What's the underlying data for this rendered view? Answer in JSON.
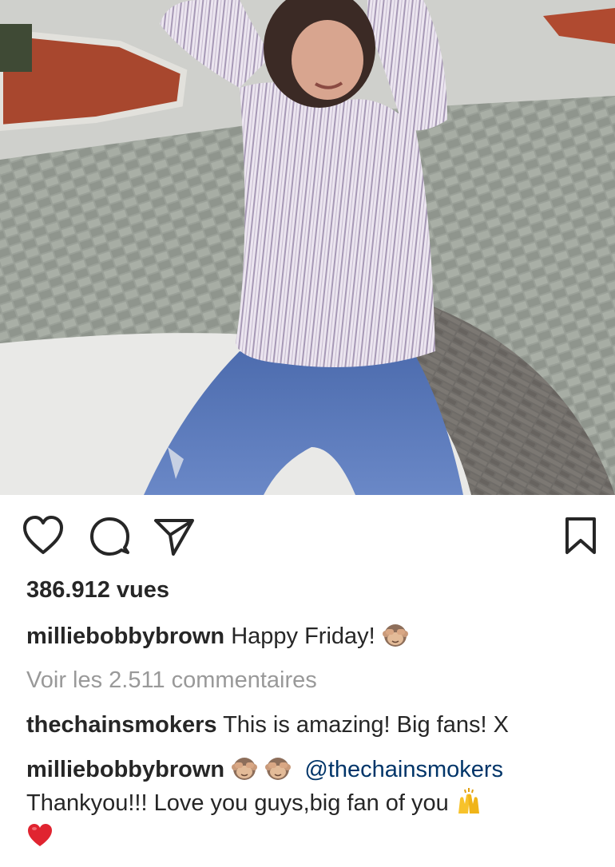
{
  "post": {
    "views": "386.912 vues",
    "caption": {
      "username": "milliebobbybrown",
      "text": "Happy Friday!",
      "emoji": "see-no-evil-monkey"
    },
    "view_comments_label": "Voir les 2.511 commentaires",
    "comments": [
      {
        "username": "thechainsmokers",
        "text": "This is amazing! Big fans! X"
      },
      {
        "username": "milliebobbybrown",
        "emojis_before": [
          "see-no-evil-monkey",
          "see-no-evil-monkey"
        ],
        "mention": "@thechainsmokers",
        "text": "Thankyou!!! Love you guys,big fan of you",
        "emojis_after": [
          "raising-hands",
          "red-heart"
        ]
      }
    ]
  },
  "actions": {
    "icons": [
      "heart-icon",
      "comment-icon",
      "share-icon",
      "bookmark-icon"
    ]
  },
  "colors": {
    "text": "#262626",
    "muted": "#999999",
    "mention": "#003569",
    "jeans": "#5a77b5",
    "shirt": "#d9cfe0",
    "pavement": "#8e948c",
    "mulch": "#b04a30"
  }
}
